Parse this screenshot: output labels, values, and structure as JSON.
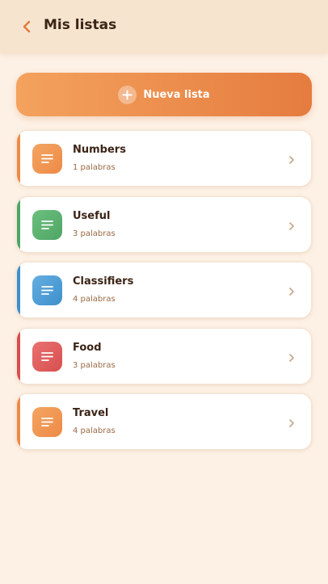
{
  "header": {
    "title": "Mis listas",
    "back_icon": "chevron-left-icon"
  },
  "new_list": {
    "label": "Nueva lista",
    "icon": "plus-icon"
  },
  "lists": [
    {
      "name": "Numbers",
      "count": "1 palabras",
      "color": "#ee8a46",
      "color_light": "#f3a562"
    },
    {
      "name": "Useful",
      "count": "3 palabras",
      "color": "#4fa565",
      "color_light": "#6cc07e"
    },
    {
      "name": "Classifiers",
      "count": "4 palabras",
      "color": "#3d90cc",
      "color_light": "#64aee0"
    },
    {
      "name": "Food",
      "count": "3 palabras",
      "color": "#d74f4f",
      "color_light": "#ea7171"
    },
    {
      "name": "Travel",
      "count": "4 palabras",
      "color": "#ee8a46",
      "color_light": "#f3a562"
    }
  ]
}
